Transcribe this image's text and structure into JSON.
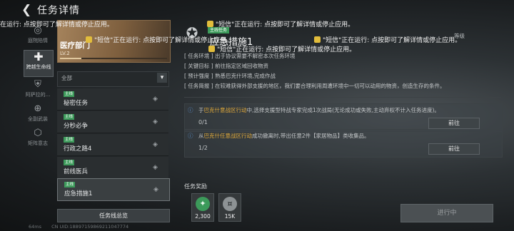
{
  "header": {
    "title": "任务详情"
  },
  "rail": {
    "items": [
      {
        "label": "庭院陷情",
        "icon": "compass-icon"
      },
      {
        "label": "跨越生命线",
        "icon": "cross-icon"
      },
      {
        "label": "阿萨拉的...",
        "icon": "shield-icon"
      },
      {
        "label": "全副武装",
        "icon": "target-icon"
      },
      {
        "label": "矩阵意志",
        "icon": "matrix-icon"
      }
    ]
  },
  "card": {
    "name": "医疗部门",
    "level": "LV.2",
    "progress": 0.2
  },
  "filter": {
    "value": "全部"
  },
  "tasks": [
    {
      "tag": "主线",
      "name": "秘密任务"
    },
    {
      "tag": "主线",
      "name": "分秒必争"
    },
    {
      "tag": "主线",
      "name": "行政之路4"
    },
    {
      "tag": "主线",
      "name": "前线医兵"
    },
    {
      "tag": "主线",
      "name": "应急措施1"
    }
  ],
  "overview_label": "任务线总览",
  "footer": {
    "ping": "64ms",
    "uid": "CN UID:18897159869211047774"
  },
  "detail": {
    "tag": "主线任务",
    "title": "应急措施1",
    "meta": "等级",
    "info": [
      "[ 任务环境 ]  出于协议需要不解密本次任务环境",
      "[ 关键目标 ]  前往指定区域回收物资",
      "[ 预计强度 ]  熟悉巴克什环境,完成作战",
      "[ 任务简报 ]  在较难获得外部支援的地区，我们要合理利用周遭环境中一切可以动用的物资，创造生存的条件。"
    ]
  },
  "objectives": [
    {
      "prefix": "于",
      "highlight": "巴克什意战区行动",
      "rest": "中,选择支援型特战专家完成1次战局(无论成功或失败,主动弃权不计入任务进度)。",
      "count": "0/1",
      "button": "前往"
    },
    {
      "prefix": "从",
      "highlight": "巴克什任意战区行动",
      "rest": "成功撤离时,带出任意2件【家居物品】类收集品。",
      "count": "1/2",
      "button": "前往"
    }
  ],
  "rewards": {
    "label": "任务奖励",
    "items": [
      {
        "icon": "emblem-icon",
        "amount": "2,300",
        "color": "#3c9a5a"
      },
      {
        "icon": "coin-icon",
        "amount": "15K",
        "color": "#8d9294"
      }
    ]
  },
  "status_button": "进行中",
  "toasts": [
    {
      "text": "在运行: 点按即可了解详情或停止应用。"
    },
    {
      "text": "\"短信\"正在运行: 点按即可了解详情或停止应用。"
    },
    {
      "text": "\"短信\"正在运行: 点按即可了解详情或停止应用。"
    },
    {
      "text": "\"短信\"正在运行: 点按即可了解详情或停止应用。"
    },
    {
      "text": "\"短信\"正在运行: 点按即可了解详情或停止应用。"
    }
  ]
}
